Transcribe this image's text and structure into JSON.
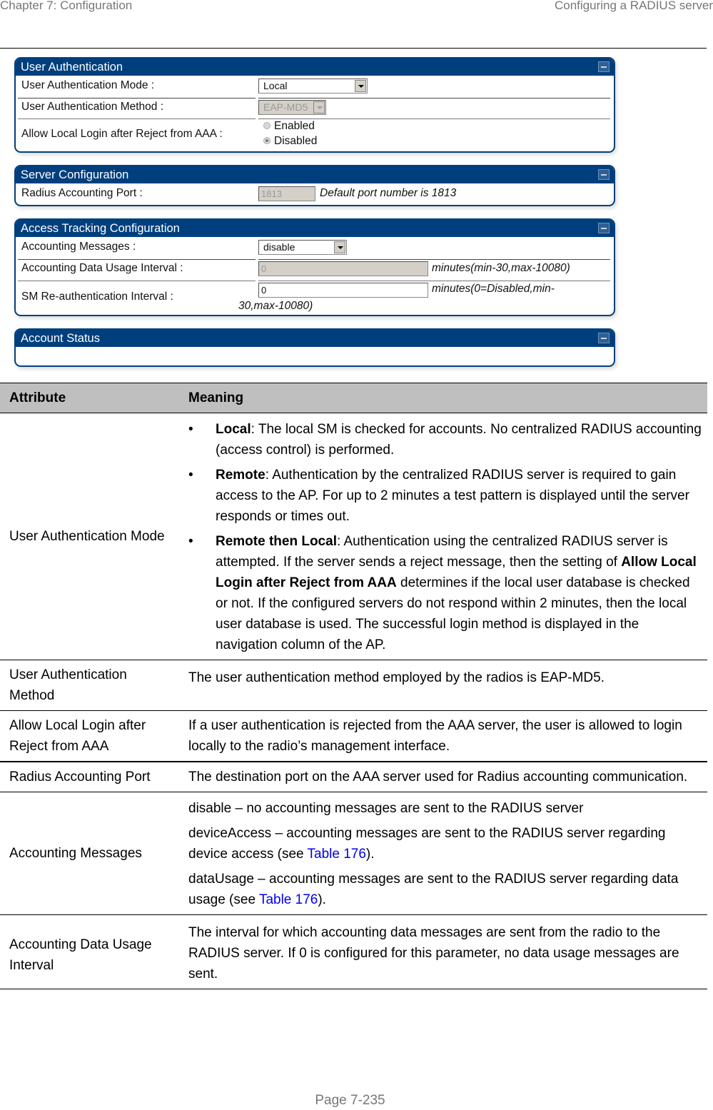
{
  "header": {
    "chapter": "Chapter 7:  Configuration",
    "section": "Configuring a RADIUS server"
  },
  "panels": {
    "user_auth": {
      "title": "User Authentication",
      "mode_label": "User Authentication Mode :",
      "mode_value": "Local",
      "method_label": "User Authentication Method :",
      "method_value": "EAP-MD5",
      "allow_label": "Allow Local Login after Reject from AAA :",
      "allow_options": [
        "Enabled",
        "Disabled"
      ],
      "allow_selected": "Disabled"
    },
    "server_config": {
      "title": "Server Configuration",
      "port_label": "Radius Accounting Port :",
      "port_value": "1813",
      "port_hint": "Default port number is 1813"
    },
    "access_tracking": {
      "title": "Access Tracking Configuration",
      "messages_label": "Accounting Messages :",
      "messages_value": "disable",
      "usage_label": "Accounting Data Usage Interval :",
      "usage_value": "0",
      "usage_hint": "minutes(min-30,max-10080)",
      "reauth_label": "SM Re-authentication Interval :",
      "reauth_value": "0",
      "reauth_hint_1": "minutes(0=Disabled,min-",
      "reauth_hint_2": "30,max-10080)"
    },
    "account_status": {
      "title": "Account Status"
    }
  },
  "table": {
    "headers": [
      "Attribute",
      "Meaning"
    ],
    "rows": [
      {
        "attribute": "User Authentication Mode",
        "bullets": [
          {
            "term": "Local",
            "text": ": The local SM is checked for accounts. No centralized RADIUS accounting (access control) is performed."
          },
          {
            "term": "Remote",
            "text": ": Authentication by the centralized RADIUS server is required to gain access to the AP. For up to 2 minutes a test pattern is displayed until the server responds or times out."
          },
          {
            "term": "Remote then Local",
            "text_a": ": Authentication using the centralized RADIUS server is attempted. If the server sends a reject message, then the setting of ",
            "bold_mid": "Allow Local Login after Reject from AAA",
            "text_b": " determines if the local user database is checked or not. If the configured servers do not respond within 2 minutes, then the local user database is used. The successful login method is displayed in the navigation column of the AP."
          }
        ]
      },
      {
        "attribute": "User Authentication Method",
        "meaning": "The user authentication method employed by the radios is EAP-MD5."
      },
      {
        "attribute": "Allow Local Login after Reject from AAA",
        "meaning": "If a user authentication is rejected from the AAA server, the user is allowed to login locally to the radio’s management interface."
      },
      {
        "attribute": "Radius Accounting Port",
        "meaning": "The destination port on the AAA server used for Radius accounting communication."
      },
      {
        "attribute": "Accounting Messages",
        "paras": [
          {
            "text": "disable – no accounting messages are sent to the RADIUS server"
          },
          {
            "text": "deviceAccess – accounting messages are sent to the RADIUS server regarding device access (see ",
            "link": "Table 176",
            "after": ")."
          },
          {
            "text": "dataUsage – accounting messages are sent to the RADIUS server regarding data usage (see ",
            "link": "Table 176",
            "after": ")."
          }
        ]
      },
      {
        "attribute": "Accounting Data Usage Interval",
        "meaning": "The interval for which accounting data messages are sent from the radio to the RADIUS server. If 0 is configured for this parameter, no data usage messages are sent."
      }
    ]
  },
  "footer": {
    "page": "Page 7-235"
  }
}
